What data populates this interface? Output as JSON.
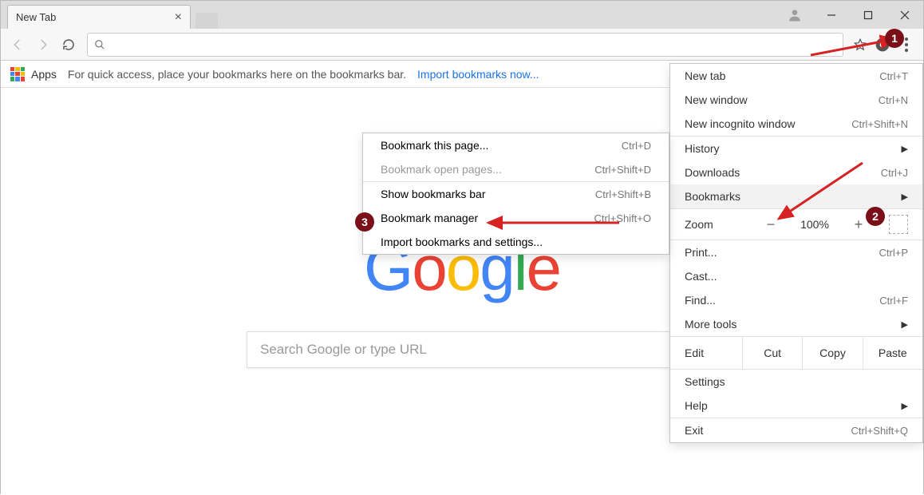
{
  "tab": {
    "title": "New Tab"
  },
  "bookmarkbar": {
    "apps_label": "Apps",
    "hint": "For quick access, place your bookmarks here on the bookmarks bar.",
    "import_link": "Import bookmarks now..."
  },
  "searchbox": {
    "placeholder": "Search Google or type URL"
  },
  "menu": {
    "new_tab": "New tab",
    "new_tab_sc": "Ctrl+T",
    "new_window": "New window",
    "new_window_sc": "Ctrl+N",
    "new_incognito": "New incognito window",
    "new_incognito_sc": "Ctrl+Shift+N",
    "history": "History",
    "downloads": "Downloads",
    "downloads_sc": "Ctrl+J",
    "bookmarks": "Bookmarks",
    "zoom_label": "Zoom",
    "zoom_value": "100%",
    "print": "Print...",
    "print_sc": "Ctrl+P",
    "cast": "Cast...",
    "find": "Find...",
    "find_sc": "Ctrl+F",
    "more_tools": "More tools",
    "edit_label": "Edit",
    "cut": "Cut",
    "copy": "Copy",
    "paste": "Paste",
    "settings": "Settings",
    "help": "Help",
    "exit": "Exit",
    "exit_sc": "Ctrl+Shift+Q"
  },
  "submenu": {
    "bookmark_page": "Bookmark this page...",
    "bookmark_page_sc": "Ctrl+D",
    "bookmark_open": "Bookmark open pages...",
    "bookmark_open_sc": "Ctrl+Shift+D",
    "show_bar": "Show bookmarks bar",
    "show_bar_sc": "Ctrl+Shift+B",
    "manager": "Bookmark manager",
    "manager_sc": "Ctrl+Shift+O",
    "import_settings": "Import bookmarks and settings..."
  },
  "google_letters": [
    {
      "c": "G",
      "color": "#4285F4"
    },
    {
      "c": "o",
      "color": "#EA4335"
    },
    {
      "c": "o",
      "color": "#FBBC05"
    },
    {
      "c": "g",
      "color": "#4285F4"
    },
    {
      "c": "l",
      "color": "#34A853"
    },
    {
      "c": "e",
      "color": "#EA4335"
    }
  ],
  "badges": {
    "one": "1",
    "two": "2",
    "three": "3"
  },
  "apps_colors": [
    "#ea4335",
    "#fbbc05",
    "#34a853",
    "#4285f4",
    "#ea4335",
    "#fbbc05",
    "#34a853",
    "#4285f4",
    "#ea4335"
  ]
}
